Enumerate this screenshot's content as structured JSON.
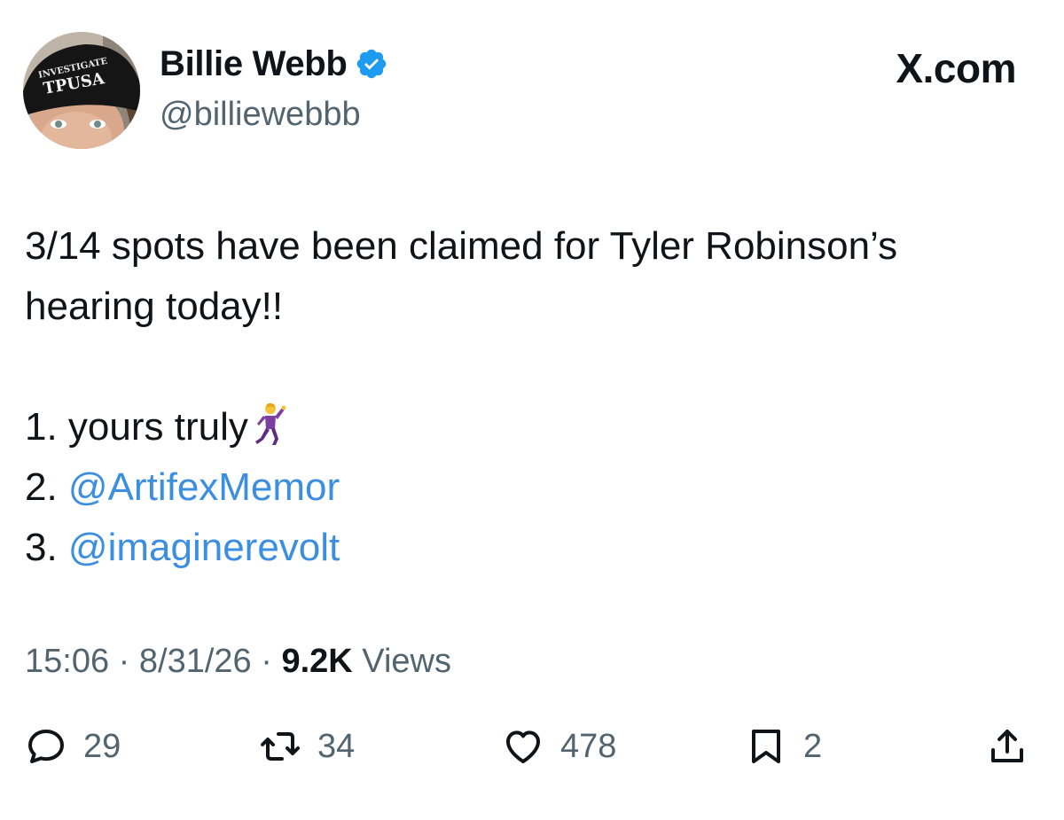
{
  "header": {
    "display_name": "Billie Webb",
    "handle": "@billiewebbb",
    "brand": "X.com",
    "avatar_cap_text": "INVESTIGATE TPUSA"
  },
  "tweet": {
    "line1": "3/14 spots have been claimed for Tyler Robinson’s",
    "line2": "hearing today!!",
    "list": [
      {
        "prefix": "1. ",
        "text": "yours truly",
        "emoji": "person-dancing-icon"
      },
      {
        "prefix": "2. ",
        "mention": "@ArtifexMemor"
      },
      {
        "prefix": "3. ",
        "mention": "@imaginerevolt"
      }
    ]
  },
  "meta": {
    "time": "15:06",
    "separator": "·",
    "date": "8/31/26",
    "views_count": "9.2K",
    "views_label": "Views"
  },
  "actions": {
    "replies": "29",
    "reposts": "34",
    "likes": "478",
    "bookmarks": "2"
  },
  "colors": {
    "text": "#0f1419",
    "secondary": "#536471",
    "mention": "#3b8ee0",
    "verified": "#1d9bf0"
  }
}
